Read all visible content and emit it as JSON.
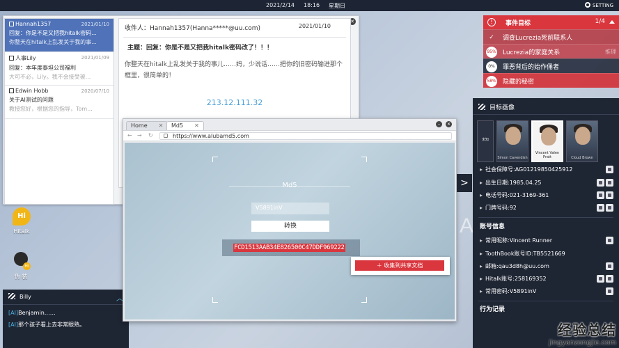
{
  "topbar": {
    "date": "2021/2/14",
    "time": "18:16",
    "weekday": "星期日",
    "setting": "SETTING"
  },
  "mail": {
    "list": [
      {
        "from": "Hannah1357",
        "date": "2021/01/10",
        "subject": "回复：你是不是又把我hitalk密码...",
        "preview": "你整天在hitalk上乱发关于我的事...",
        "active": true
      },
      {
        "from": "人事Lily",
        "date": "2021/01/09",
        "subject": "回复：本年度泰坦公司福利",
        "preview": "大可不必，Lily。我不会接受被...",
        "active": false
      },
      {
        "from": "Edwin Hobb",
        "date": "2020/07/10",
        "subject": "关于AI测试的问题",
        "preview": "教授您好，根据您的指导，Tom...",
        "active": false
      }
    ],
    "detail": {
      "recipient": "收件人：Hannah1357(Hanna*****@uu.com)",
      "date": "2021/01/10",
      "subject": "主题：回复：你是不是又把我hitalk密码改了！！！",
      "body": "你整天在hitalk上乱发关于我的事儿……妈，少说话……把你的旧密码输进那个框里，很简单的！",
      "ip": "213.12.111.32"
    }
  },
  "desktop": {
    "hitalk_icon_text": "Hi",
    "hitalk_label": "Hitalk",
    "disguise_badge": "Hi",
    "disguise_label": "伪 装"
  },
  "chat": {
    "name": "Billy",
    "messages": [
      {
        "tag": "[AI]",
        "text": "Benjamin……"
      },
      {
        "tag": "[AI]",
        "text": "那个孩子看上去非常眼熟。"
      }
    ]
  },
  "browser": {
    "tabs": [
      {
        "label": "Home"
      },
      {
        "label": "Md5"
      }
    ],
    "url": "https://www.alubamd5.com",
    "md5": {
      "title": "Md5",
      "input_value": "V5891inV",
      "convert_label": "转换",
      "result": "FCD1513AAB34E826500C47DDF969222",
      "menu_item": "收集到共享文档"
    }
  },
  "watermark_letter": "A",
  "goal": {
    "title": "事件目标",
    "count": "1/4",
    "items": [
      {
        "pct": "",
        "label": "调查Lucrezia死前联系人",
        "sub": ""
      },
      {
        "pct": "95%",
        "label": "Lucrezia的家庭关系",
        "sub": "推理"
      },
      {
        "pct": "0%",
        "label": "罪恶背后的始作俑者",
        "sub": ""
      },
      {
        "pct": "58%",
        "label": "隐藏的秘密",
        "sub": ""
      }
    ]
  },
  "profile": {
    "title": "目标画像",
    "photos": [
      {
        "name": "未知"
      },
      {
        "name": "Simon Cavendish"
      },
      {
        "name": "Vincent Valen Pratt"
      },
      {
        "name": "Cloud Brown"
      }
    ],
    "info_rows": [
      "社会保障号:AG012198504259​12",
      "出生日期:1985.04.25",
      "电话号码:021-3169-361",
      "门牌号码:92"
    ],
    "account_title": "账号信息",
    "account_rows": [
      "常用昵称:Vincent Runner",
      "ToothBook账号ID:TB5521669",
      "邮箱:qau3d8h@uu.com",
      "Hitalk账号:258169352",
      "常用密码:V5891inV"
    ],
    "bottom_section": "行为记录",
    "expander": ">"
  },
  "site_watermark": {
    "cn": "经验总结",
    "en": "jingyanzongjie.com"
  },
  "colors": {
    "accent_red": "#d9363e",
    "panel_dark": "#1e2533",
    "mail_selected": "#4f72b8",
    "link_blue": "#4aa0d8"
  }
}
